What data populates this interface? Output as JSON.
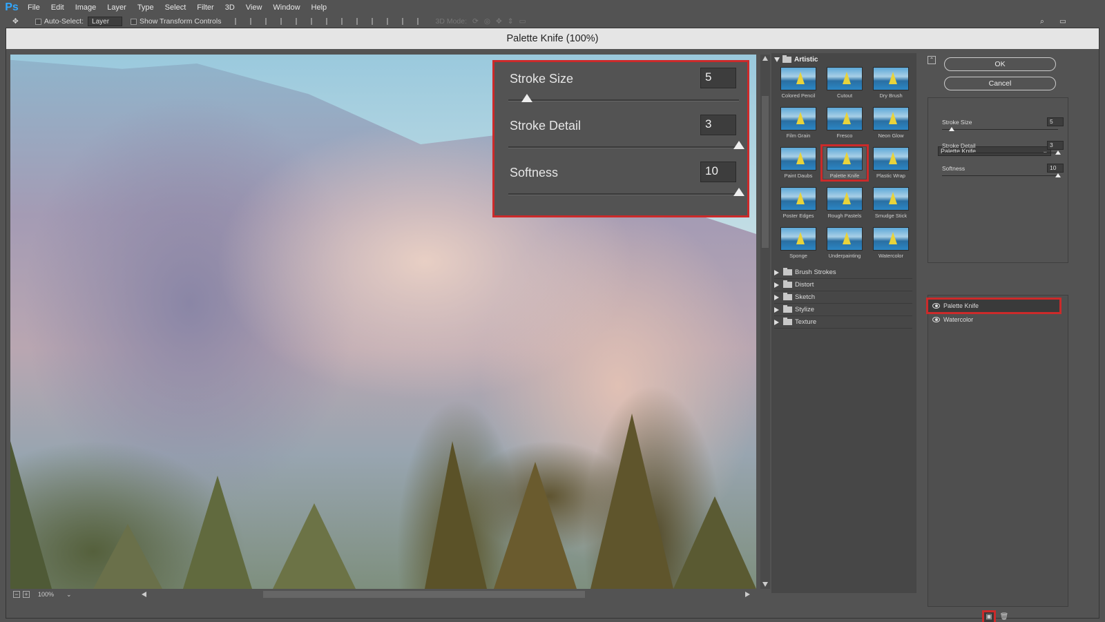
{
  "app": {
    "logo": "Ps"
  },
  "menu": [
    "File",
    "Edit",
    "Image",
    "Layer",
    "Type",
    "Select",
    "Filter",
    "3D",
    "View",
    "Window",
    "Help"
  ],
  "options": {
    "auto_select_label": "Auto-Select:",
    "auto_select_value": "Layer",
    "show_transform_label": "Show Transform Controls",
    "mode_label": "3D Mode:"
  },
  "dialog": {
    "title": "Palette Knife (100%)",
    "zoom": "100%",
    "overlay": {
      "stroke_size_label": "Stroke Size",
      "stroke_size_value": "5",
      "stroke_detail_label": "Stroke Detail",
      "stroke_detail_value": "3",
      "softness_label": "Softness",
      "softness_value": "10"
    }
  },
  "gallery": {
    "open_category": "Artistic",
    "thumbs": [
      "Colored Pencil",
      "Cutout",
      "Dry Brush",
      "Film Grain",
      "Fresco",
      "Neon Glow",
      "Paint Daubs",
      "Palette Knife",
      "Plastic Wrap",
      "Poster Edges",
      "Rough Pastels",
      "Smudge Stick",
      "Sponge",
      "Underpainting",
      "Watercolor"
    ],
    "selected": "Palette Knife",
    "categories": [
      "Brush Strokes",
      "Distort",
      "Sketch",
      "Stylize",
      "Texture"
    ]
  },
  "right": {
    "ok": "OK",
    "cancel": "Cancel",
    "filter_select": "Palette Knife",
    "stroke_size_label": "Stroke Size",
    "stroke_size_value": "5",
    "stroke_detail_label": "Stroke Detail",
    "stroke_detail_value": "3",
    "softness_label": "Softness",
    "softness_value": "10",
    "layers": [
      "Palette Knife",
      "Watercolor"
    ]
  },
  "sliders": {
    "stroke_size": {
      "value": 5,
      "min": 1,
      "max": 50
    },
    "stroke_detail": {
      "value": 3,
      "min": 1,
      "max": 3
    },
    "softness": {
      "value": 10,
      "min": 0,
      "max": 10
    }
  }
}
